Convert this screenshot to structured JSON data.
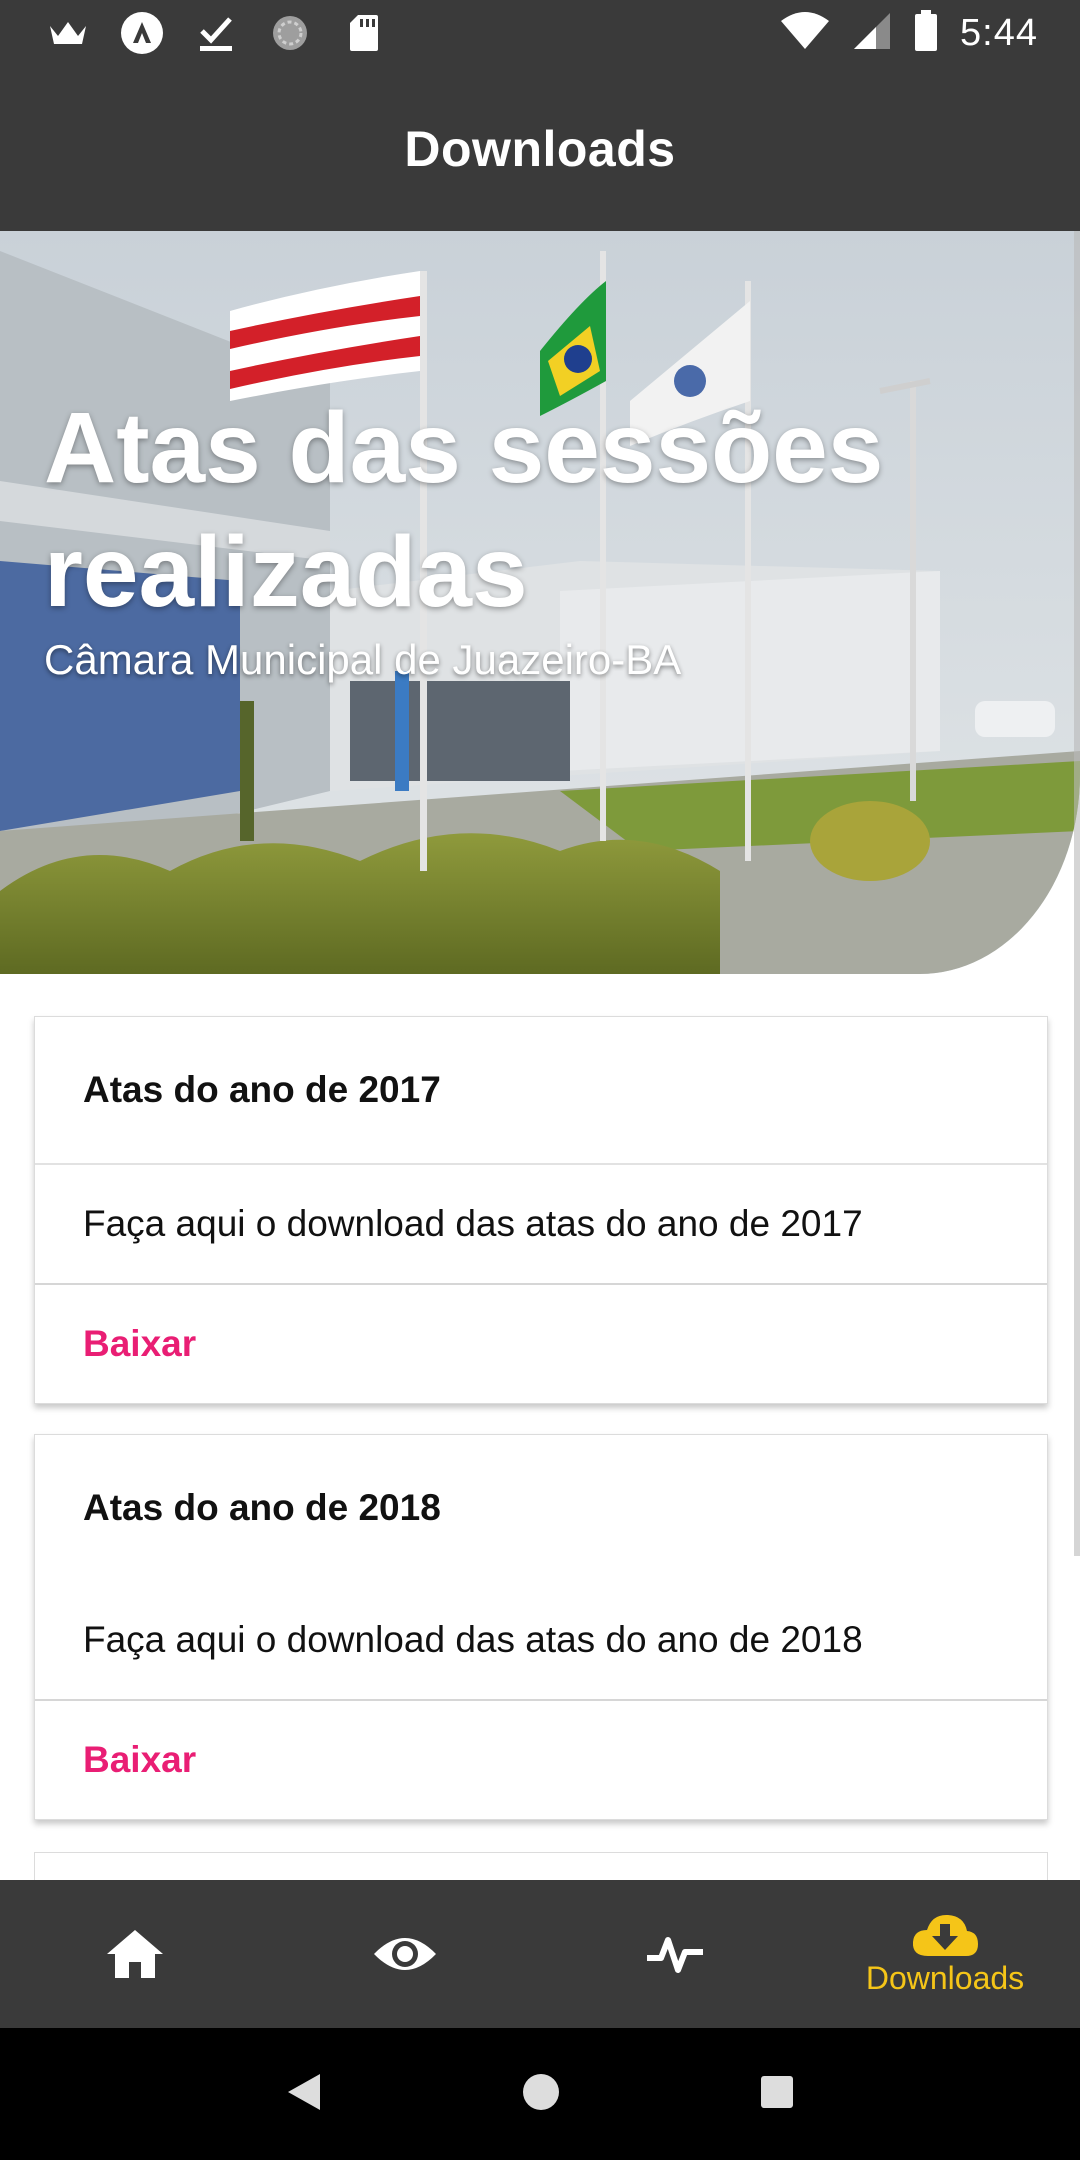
{
  "status_bar": {
    "time": "5:44",
    "left_icons": [
      "crown-icon",
      "app-icon",
      "download-done-icon",
      "sync-icon",
      "sd-card-icon"
    ],
    "right_icons": [
      "wifi-icon",
      "signal-icon",
      "battery-icon"
    ]
  },
  "app_bar": {
    "title": "Downloads"
  },
  "hero": {
    "title": "Atas das sessões realizadas",
    "subtitle": "Câmara Municipal de Juazeiro-BA"
  },
  "cards": [
    {
      "title": "Atas do ano de 2017",
      "description": "Faça aqui o download das atas do ano de 2017",
      "action": "Baixar"
    },
    {
      "title": "Atas do ano de 2018",
      "description": "Faça aqui o download das atas do ano de 2018",
      "action": "Baixar"
    }
  ],
  "bottom_nav": {
    "items": [
      {
        "icon": "home-icon",
        "label": ""
      },
      {
        "icon": "eye-icon",
        "label": ""
      },
      {
        "icon": "activity-icon",
        "label": ""
      },
      {
        "icon": "cloud-download-icon",
        "label": "Downloads",
        "active": true
      }
    ],
    "active_color": "#f5c518"
  },
  "colors": {
    "bar_background": "#3a3a3a",
    "action_color": "#e91e74"
  }
}
